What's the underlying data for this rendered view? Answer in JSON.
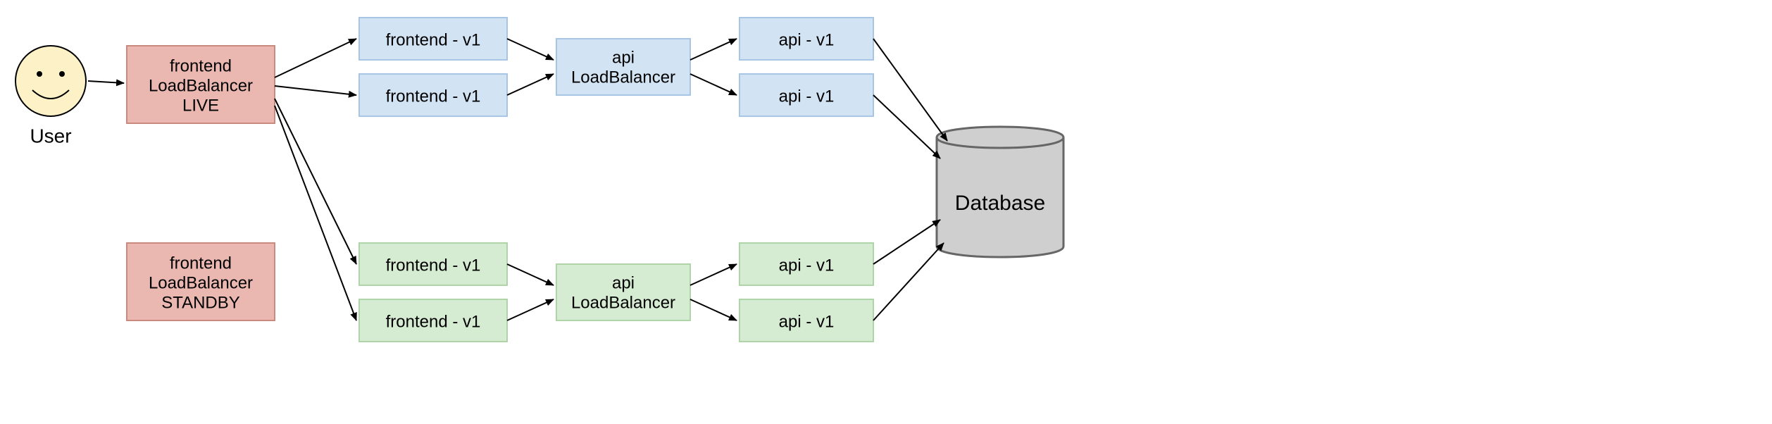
{
  "user": {
    "label": "User"
  },
  "frontend_lb_live": {
    "line1": "frontend",
    "line2": "LoadBalancer",
    "line3": "LIVE"
  },
  "frontend_lb_standby": {
    "line1": "frontend",
    "line2": "LoadBalancer",
    "line3": "STANDBY"
  },
  "frontend_blue_1": {
    "label": "frontend - v1"
  },
  "frontend_blue_2": {
    "label": "frontend - v1"
  },
  "frontend_green_1": {
    "label": "frontend - v1"
  },
  "frontend_green_2": {
    "label": "frontend - v1"
  },
  "api_lb_blue": {
    "line1": "api",
    "line2": "LoadBalancer"
  },
  "api_lb_green": {
    "line1": "api",
    "line2": "LoadBalancer"
  },
  "api_blue_1": {
    "label": "api - v1"
  },
  "api_blue_2": {
    "label": "api - v1"
  },
  "api_green_1": {
    "label": "api - v1"
  },
  "api_green_2": {
    "label": "api - v1"
  },
  "database": {
    "label": "Database"
  },
  "colors": {
    "pink_fill": "#eab8b0",
    "pink_stroke": "#c98a80",
    "blue_fill": "#d2e3f3",
    "blue_stroke": "#a8c6e4",
    "green_fill": "#d6ecd2",
    "green_stroke": "#aed4a7",
    "db_fill": "#cfcfcf",
    "db_stroke": "#666666",
    "face_fill": "#fdf2c7"
  }
}
